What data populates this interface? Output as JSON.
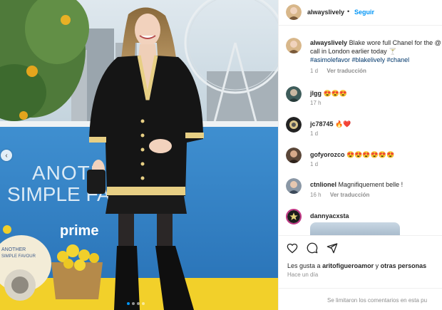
{
  "post": {
    "username": "alwayslively",
    "follow_label": "Seguir",
    "caption": "Blake wore full Chanel for the @",
    "caption_line2": "call in London earlier today 🍸",
    "hashtags": "#asimolefavor #blakelively #chanel",
    "caption_age": "1 d",
    "see_translation": "Ver traducción"
  },
  "photo": {
    "signage": [
      "ANOTHER",
      "SIMPLE FAV",
      "prime",
      "ANOTHER",
      "SIMPLE FAVOUR"
    ],
    "carousel": {
      "count": 4,
      "active": 1
    }
  },
  "comments": [
    {
      "user": "jlgg",
      "text": "😍😍😍",
      "age": "17 h",
      "reply": ""
    },
    {
      "user": "jc78745",
      "text": "🔥❤️",
      "age": "1 d",
      "reply": ""
    },
    {
      "user": "gofyorozco",
      "text": "😍😍😍😍😍😍",
      "age": "1 d",
      "reply": ""
    },
    {
      "user": "ctnlionel",
      "text": "Magnifiquement belle !",
      "age": "16 h",
      "reply": "Ver traducción"
    },
    {
      "user": "dannyacxsta",
      "text": "",
      "age": "",
      "reply": ""
    }
  ],
  "likes": {
    "prefix": "Les gusta a",
    "user": "aritofigueroamor",
    "middle": "y",
    "others": "otras personas"
  },
  "posted_time": "Hace un día",
  "comments_limited": "Se limitaron los comentarios en esta pu",
  "colors": {
    "accent": "#0095f6",
    "muted": "#8e8e8e",
    "heart": "#ed4956"
  }
}
